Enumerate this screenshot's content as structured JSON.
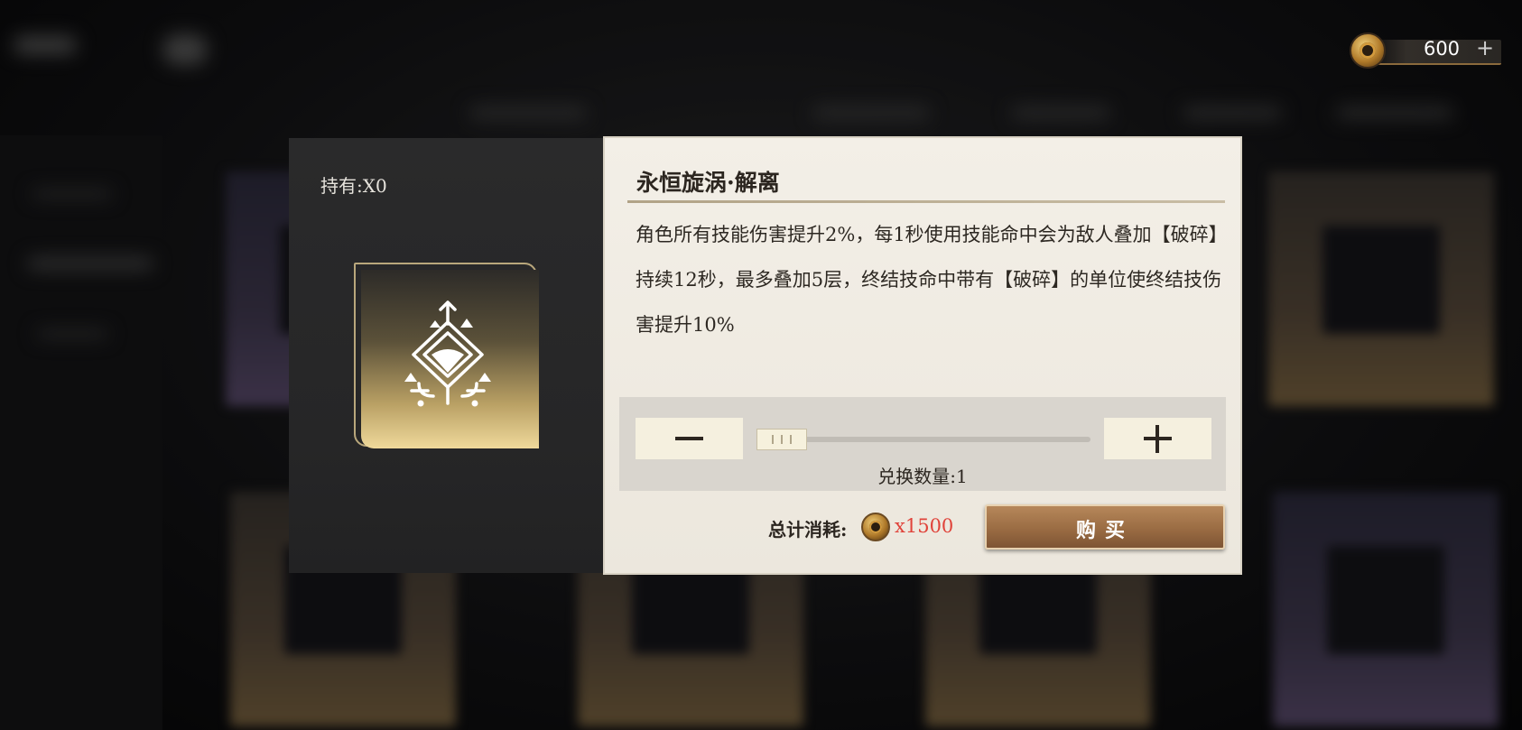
{
  "currency": {
    "amount": "600",
    "add_label": "+",
    "icon": "coin-icon"
  },
  "dialog": {
    "holding_label": "持有:X0",
    "item_icon": "rune-emblem-icon",
    "item_title": "永恒旋涡·解离",
    "item_description": "角色所有技能伤害提升2%，每1秒使用技能命中会为敌人叠加【破碎】持续12秒，最多叠加5层，终结技命中带有【破碎】的单位使终结技伤害提升10%",
    "quantity": {
      "minus_label": "−",
      "plus_label": "+",
      "label": "兑换数量:1",
      "value": 1
    },
    "cost": {
      "label": "总计消耗:",
      "value": "x1500",
      "icon": "coin-icon"
    },
    "buy_label": "购买"
  },
  "colors": {
    "accent_gold": "#b9a064",
    "cost_red": "#e0433a",
    "buy_button": "#9a6c43",
    "panel_light": "#f3efe7",
    "panel_dark": "#2a2a2b"
  }
}
